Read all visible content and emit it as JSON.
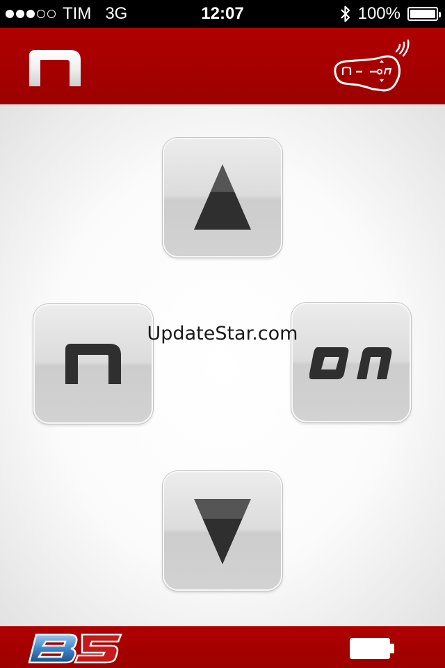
{
  "status_bar": {
    "signal_bars": 3,
    "signal_total": 5,
    "carrier": "TIM",
    "network": "3G",
    "time": "12:07",
    "bluetooth_icon": "bluetooth-icon",
    "battery_percent_label": "100%",
    "battery_level": 1.0
  },
  "header": {
    "logo_icon": "n-logo-icon",
    "device_icon": "nolan-n-com-intercom-wireless-icon",
    "device_label": "n · ON"
  },
  "controls": {
    "up": {
      "icon": "triangle-up-icon"
    },
    "left": {
      "icon": "n-logo-icon"
    },
    "right": {
      "icon": "on-logo-icon"
    },
    "down": {
      "icon": "triangle-down-icon"
    }
  },
  "watermark": "UpdateStar.com",
  "footer": {
    "logo_text": "B5",
    "logo_icon": "b5-logo-icon",
    "battery_icon": "battery-icon"
  },
  "colors": {
    "brand_red": "#a80000",
    "button_gray": "#d9d9d9",
    "glyph_dark": "#2d2d2d",
    "b5_blue": "#2a6fb5"
  }
}
